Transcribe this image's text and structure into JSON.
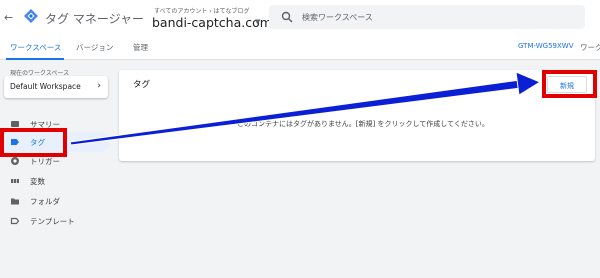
{
  "header": {
    "back_icon": "arrow-left-icon",
    "logo_icon": "tag-manager-logo-icon",
    "app_title": "タグ マネージャー",
    "account_breadcrumb": "すべてのアカウント › はてなブログ",
    "container_name": "bandi-captcha.com",
    "search_placeholder": "検索ワークスペース"
  },
  "tabs": [
    {
      "label": "ワークスペース",
      "active": true
    },
    {
      "label": "バージョン",
      "active": false
    },
    {
      "label": "管理",
      "active": false
    }
  ],
  "container_id": "GTM-WG59XWV",
  "workspace_tab_cut": "ワーク",
  "sidebar": {
    "workspace_label": "現在のワークスペース",
    "workspace_name": "Default Workspace",
    "items": [
      {
        "label": "サマリー",
        "icon": "summary-icon",
        "active": false
      },
      {
        "label": "タグ",
        "icon": "tag-icon",
        "active": true
      },
      {
        "label": "トリガー",
        "icon": "trigger-icon",
        "active": false
      },
      {
        "label": "変数",
        "icon": "variables-icon",
        "active": false
      },
      {
        "label": "フォルダ",
        "icon": "folder-icon",
        "active": false
      },
      {
        "label": "テンプレート",
        "icon": "template-icon",
        "active": false
      }
    ]
  },
  "main": {
    "card_title": "タグ",
    "new_button": "新規",
    "empty_message": "このコンテナにはタグがありません。[新規] をクリックして作成してください。"
  },
  "colors": {
    "accent": "#1a73e8",
    "annotation_red": "#e00000",
    "annotation_arrow": "#0a1fd6"
  }
}
